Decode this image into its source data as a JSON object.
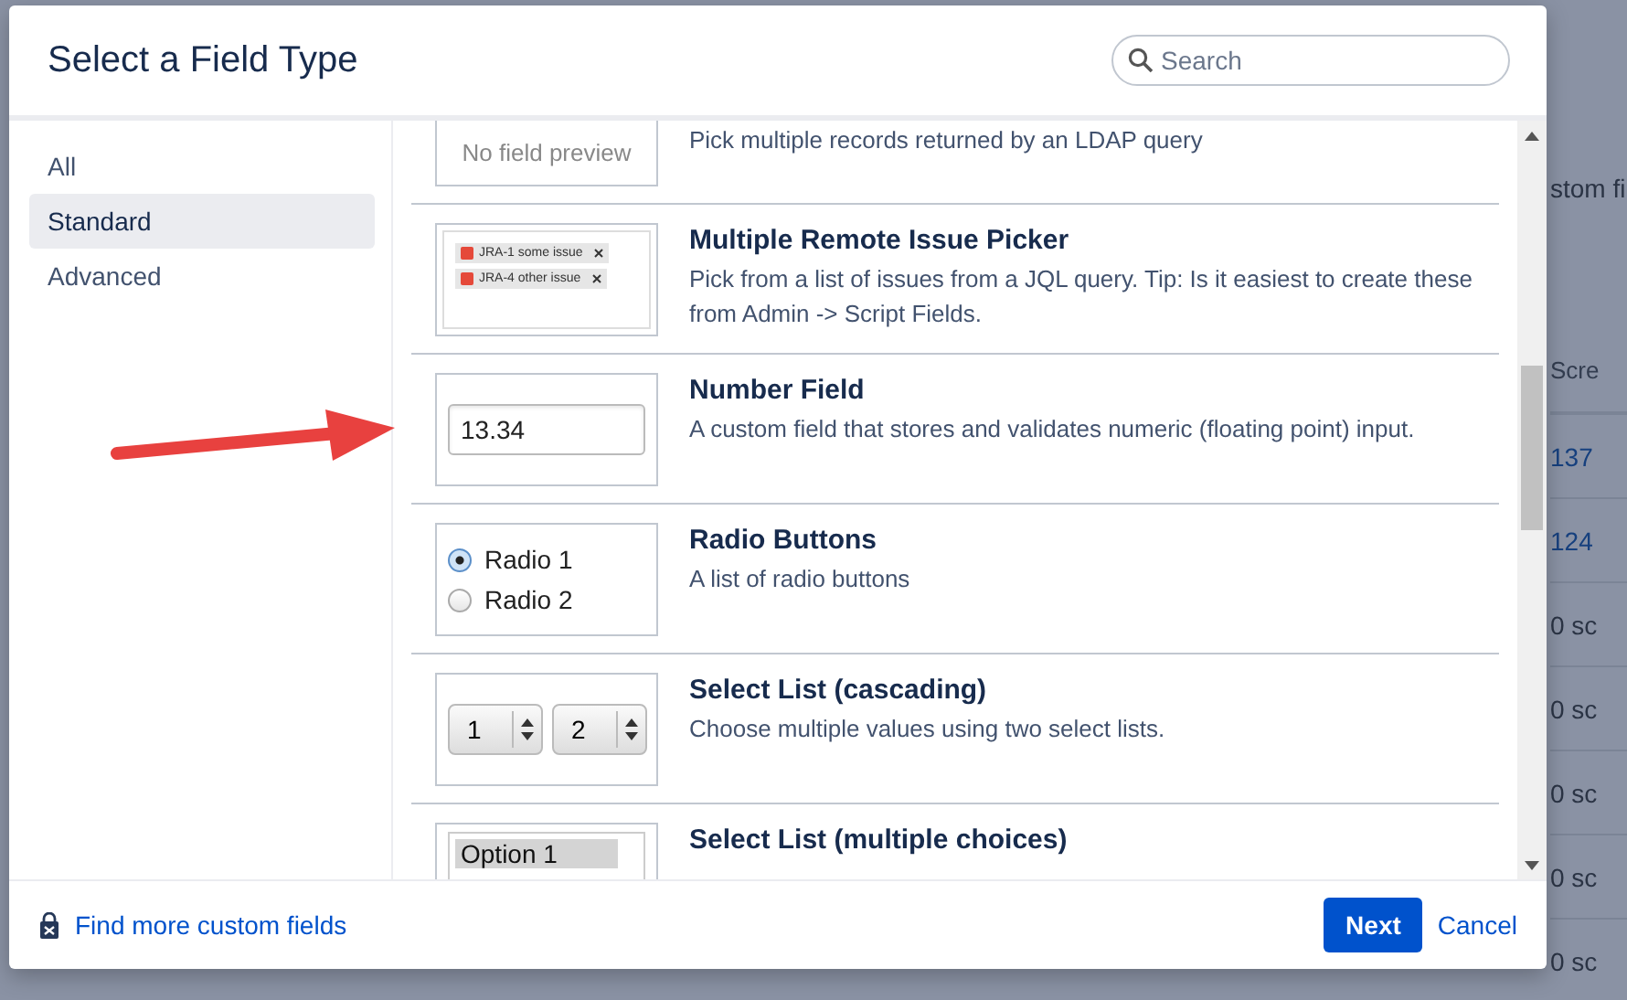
{
  "background_page": {
    "heading": "stom fi",
    "column_header": "Scre",
    "cells": [
      {
        "text": "137",
        "kind": "link"
      },
      {
        "text": "124",
        "kind": "link"
      },
      {
        "text": "0 sc",
        "kind": "plain"
      },
      {
        "text": "0 sc",
        "kind": "plain"
      },
      {
        "text": "0 sc",
        "kind": "plain"
      },
      {
        "text": "0 sc",
        "kind": "plain"
      },
      {
        "text": "0 sc",
        "kind": "plain"
      }
    ]
  },
  "dialog": {
    "title": "Select a Field Type",
    "search": {
      "placeholder": "Search"
    },
    "sidebar": {
      "items": [
        {
          "label": "All",
          "selected": false
        },
        {
          "label": "Standard",
          "selected": true
        },
        {
          "label": "Advanced",
          "selected": false
        }
      ]
    },
    "field_types": [
      {
        "kind": "none",
        "preview": {
          "text": "No field preview"
        },
        "description": "Pick multiple records returned by an LDAP query"
      },
      {
        "kind": "issue-picker",
        "title": "Multiple Remote Issue Picker",
        "preview": {
          "issues": [
            "JRA-1 some issue",
            "JRA-4 other issue"
          ]
        },
        "description": "Pick from a list of issues from a JQL query. Tip: Is it easiest to create these from Admin -> Script Fields."
      },
      {
        "kind": "number",
        "title": "Number Field",
        "preview": {
          "value": "13.34"
        },
        "description": "A custom field that stores and validates numeric (floating point) input."
      },
      {
        "kind": "radio",
        "title": "Radio Buttons",
        "preview": {
          "options": [
            {
              "label": "Radio 1",
              "selected": true
            },
            {
              "label": "Radio 2",
              "selected": false
            }
          ]
        },
        "description": "A list of radio buttons"
      },
      {
        "kind": "cascade",
        "title": "Select List (cascading)",
        "preview": {
          "selects": [
            "1",
            "2"
          ]
        },
        "description": "Choose multiple values using two select lists."
      },
      {
        "kind": "multiselect",
        "title": "Select List (multiple choices)",
        "preview": {
          "options": [
            "Option 1"
          ]
        }
      }
    ],
    "footer": {
      "link": "Find more custom fields",
      "primary_button": "Next",
      "cancel": "Cancel"
    }
  }
}
